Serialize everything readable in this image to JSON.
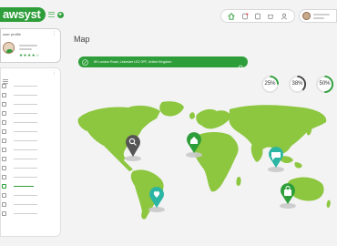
{
  "brand": {
    "name": "awsyst"
  },
  "profile": {
    "title": "user profile",
    "stars": "★★★★☆"
  },
  "page": {
    "title": "Map"
  },
  "search": {
    "address": "89 London Road, Leicester LE2 0PF, United Kingdom"
  },
  "gauges": [
    {
      "label": "25%",
      "value": 0.25
    },
    {
      "label": "38%",
      "value": 0.38
    },
    {
      "label": "50%",
      "value": 0.5
    }
  ],
  "colors": {
    "accent": "#2e9e3a",
    "map_land": "#8dc63f",
    "dark_pin": "#555555",
    "light_pin": "#2e9e3a"
  },
  "map_pins": [
    {
      "name": "search-pin",
      "icon": "magnifier-icon",
      "color": "dark"
    },
    {
      "name": "home-pin",
      "icon": "house-icon",
      "color": "green"
    },
    {
      "name": "chat-pin",
      "icon": "chat-bubble-icon",
      "color": "green"
    },
    {
      "name": "heart-pin",
      "icon": "heart-icon",
      "color": "green"
    },
    {
      "name": "bag-pin",
      "icon": "shopping-bag-icon",
      "color": "green"
    }
  ]
}
